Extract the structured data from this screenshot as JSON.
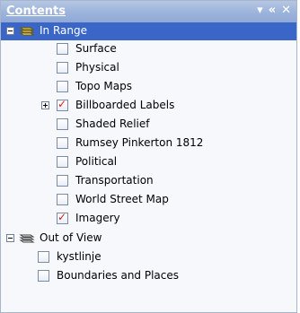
{
  "panel": {
    "title": "Contents",
    "controls": {
      "dropdown": "▾",
      "collapse": "«",
      "close": "✕"
    }
  },
  "tree": {
    "groups": [
      {
        "label": "In Range",
        "expanded": true,
        "selected": true,
        "items": [
          {
            "label": "Surface",
            "checked": false
          },
          {
            "label": "Physical",
            "checked": false
          },
          {
            "label": "Topo Maps",
            "checked": false
          },
          {
            "label": "Billboarded Labels",
            "checked": true,
            "expandable": true
          },
          {
            "label": "Shaded Relief",
            "checked": false
          },
          {
            "label": "Rumsey Pinkerton 1812",
            "checked": false
          },
          {
            "label": "Political",
            "checked": false
          },
          {
            "label": "Transportation",
            "checked": false
          },
          {
            "label": "World Street Map",
            "checked": false
          },
          {
            "label": "Imagery",
            "checked": true
          }
        ]
      },
      {
        "label": "Out of View",
        "expanded": true,
        "selected": false,
        "items": [
          {
            "label": "kystlinje",
            "checked": false
          },
          {
            "label": "Boundaries and Places",
            "checked": false
          }
        ]
      }
    ]
  }
}
